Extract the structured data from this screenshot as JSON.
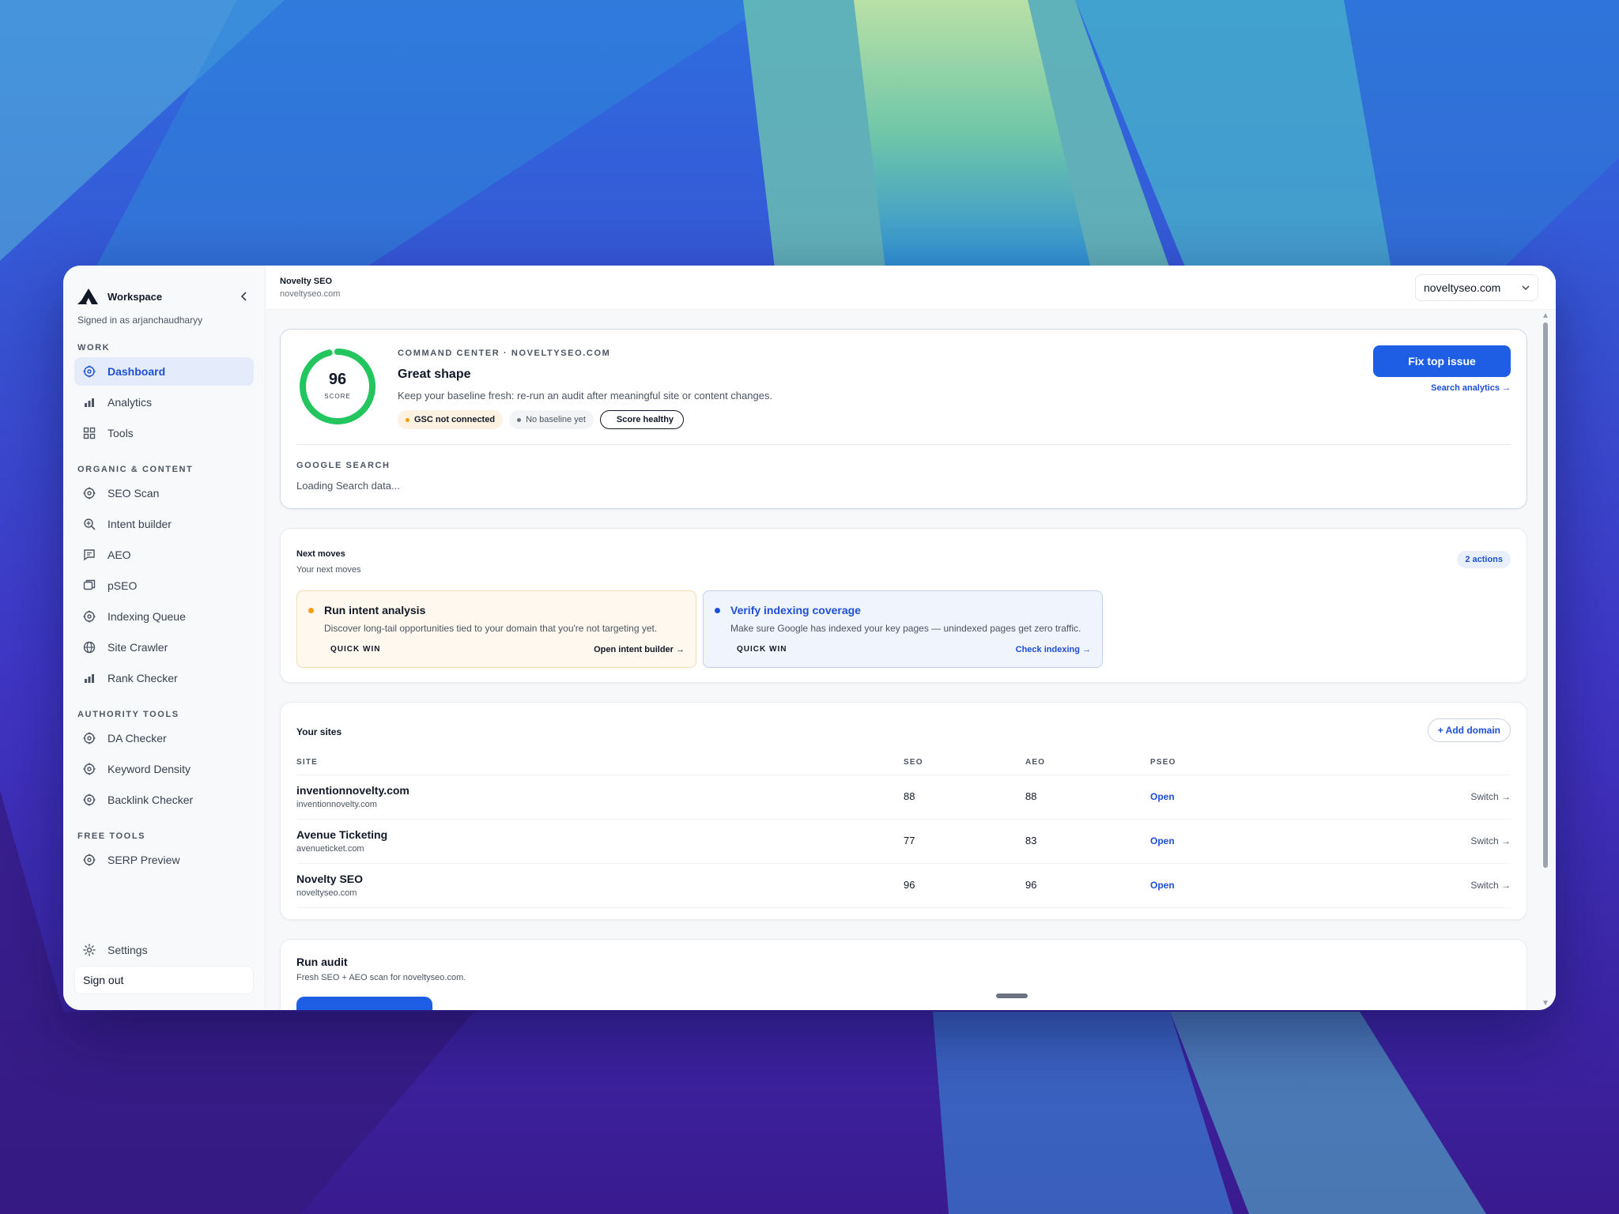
{
  "sidebar": {
    "workspace_label": "Workspace",
    "signed_in": "Signed in as arjanchaudharyy",
    "sections": {
      "work": "WORK",
      "organic": "ORGANIC & CONTENT",
      "authority": "AUTHORITY TOOLS",
      "free": "FREE TOOLS"
    },
    "work_items": [
      {
        "label": "Dashboard",
        "icon": "target-icon"
      },
      {
        "label": "Analytics",
        "icon": "bar-chart-icon"
      },
      {
        "label": "Tools",
        "icon": "grid-icon"
      }
    ],
    "organic_items": [
      {
        "label": "SEO Scan",
        "icon": "target-icon"
      },
      {
        "label": "Intent builder",
        "icon": "search-plus-icon"
      },
      {
        "label": "AEO",
        "icon": "chat-icon"
      },
      {
        "label": "pSEO",
        "icon": "pages-icon"
      },
      {
        "label": "Indexing Queue",
        "icon": "target-icon"
      },
      {
        "label": "Site Crawler",
        "icon": "globe-icon"
      },
      {
        "label": "Rank Checker",
        "icon": "bar-chart-icon"
      }
    ],
    "authority_items": [
      {
        "label": "DA Checker",
        "icon": "target-icon"
      },
      {
        "label": "Keyword Density",
        "icon": "target-icon"
      },
      {
        "label": "Backlink Checker",
        "icon": "target-icon"
      }
    ],
    "free_items": [
      {
        "label": "SERP Preview",
        "icon": "target-icon"
      }
    ],
    "settings_label": "Settings",
    "signout_label": "Sign out"
  },
  "topbar": {
    "title": "Novelty SEO",
    "subtitle": "noveltyseo.com",
    "domain_selected": "noveltyseo.com"
  },
  "command_center": {
    "score": "96",
    "score_label": "SCORE",
    "score_fraction": 0.96,
    "eyebrow": "COMMAND CENTER · NOVELTYSEO.COM",
    "title": "Great shape",
    "description": "Keep your baseline fresh: re-run an audit after meaningful site or content changes.",
    "badges": [
      "GSC not connected",
      "No baseline yet",
      "Score healthy"
    ],
    "primary_button": "Fix top issue",
    "secondary_link": "Search analytics →",
    "google_search_label": "GOOGLE SEARCH",
    "google_search_status": "Loading Search data..."
  },
  "next_moves": {
    "title": "Next moves",
    "subtitle": "Your next moves",
    "count_badge": "2 actions",
    "items": [
      {
        "title": "Run intent analysis",
        "description": "Discover long-tail opportunities tied to your domain that you're not targeting yet.",
        "tag": "QUICK WIN",
        "link": "Open intent builder →"
      },
      {
        "title": "Verify indexing coverage",
        "description": "Make sure Google has indexed your key pages — unindexed pages get zero traffic.",
        "tag": "QUICK WIN",
        "link": "Check indexing →"
      }
    ]
  },
  "sites": {
    "title": "Your sites",
    "add_button": "+ Add domain",
    "columns": [
      "SITE",
      "SEO",
      "AEO",
      "PSEO"
    ],
    "rows": [
      {
        "name": "inventionnovelty.com",
        "domain": "inventionnovelty.com",
        "seo": "88",
        "aeo": "88",
        "pseo": "Open",
        "action": "Switch →"
      },
      {
        "name": "Avenue Ticketing",
        "domain": "avenueticket.com",
        "seo": "77",
        "aeo": "83",
        "pseo": "Open",
        "action": "Switch →"
      },
      {
        "name": "Novelty SEO",
        "domain": "noveltyseo.com",
        "seo": "96",
        "aeo": "96",
        "pseo": "Open",
        "action": "Switch →"
      }
    ]
  },
  "audit": {
    "title": "Run audit",
    "subtitle": "Fresh SEO + AEO scan for noveltyseo.com."
  },
  "colors": {
    "accent": "#1d5ee5",
    "score_ring": "#22c55e",
    "warning_dot": "#f59e0b",
    "info_dot": "#1d4fd8"
  }
}
